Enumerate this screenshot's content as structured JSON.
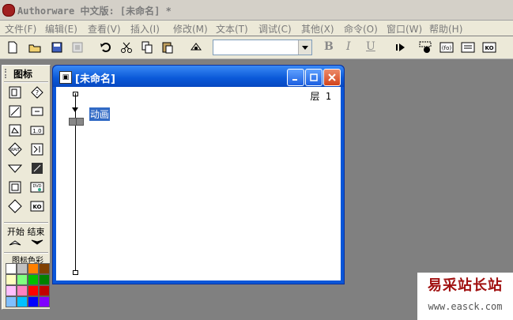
{
  "app": {
    "title": "Authorware 中文版: [未命名] *"
  },
  "menu": [
    "文件(F)",
    "编辑(E)",
    "查看(V)",
    "插入(I)",
    "修改(M)",
    "文本(T)",
    "调试(C)",
    "其他(X)",
    "命令(O)",
    "窗口(W)",
    "帮助(H)"
  ],
  "toolbar": {
    "font_value": "",
    "bold_label": "B",
    "italic_label": "I",
    "underline_label": "U",
    "icons": [
      "new-file-icon",
      "open-folder-icon",
      "save-all-icon",
      "import-icon",
      "undo-icon",
      "cut-icon",
      "copy-icon",
      "paste-icon",
      "find-icon",
      "run-icon",
      "control-panel-icon",
      "functions-icon",
      "variables-icon",
      "knowledge-objects-icon"
    ]
  },
  "palette": {
    "title": "图标",
    "icons": [
      "display-icon",
      "motion-icon",
      "erase-icon",
      "wait-icon",
      "navigate-icon",
      "framework-icon",
      "decision-icon",
      "interaction-icon",
      "calculation-icon",
      "map-icon",
      "digital-movie-icon",
      "sound-icon",
      "dvd-icon",
      "ko-icon"
    ],
    "start_label": "开始",
    "end_label": "结束",
    "color_label": "图标色彩",
    "colors": [
      "#ffffff",
      "#c0c0c0",
      "#ff8000",
      "#804000",
      "#ffffc0",
      "#80ff80",
      "#00c000",
      "#008000",
      "#ffc0ff",
      "#ff80c0",
      "#ff0000",
      "#c00000",
      "#80c0ff",
      "#00c0ff",
      "#0000ff",
      "#8000ff"
    ]
  },
  "design_window": {
    "title": "[未命名]",
    "layer_label": "层 1",
    "icon_label": "动画"
  },
  "watermark": {
    "line1": "易采站长站",
    "line2": "www.easck.com"
  }
}
